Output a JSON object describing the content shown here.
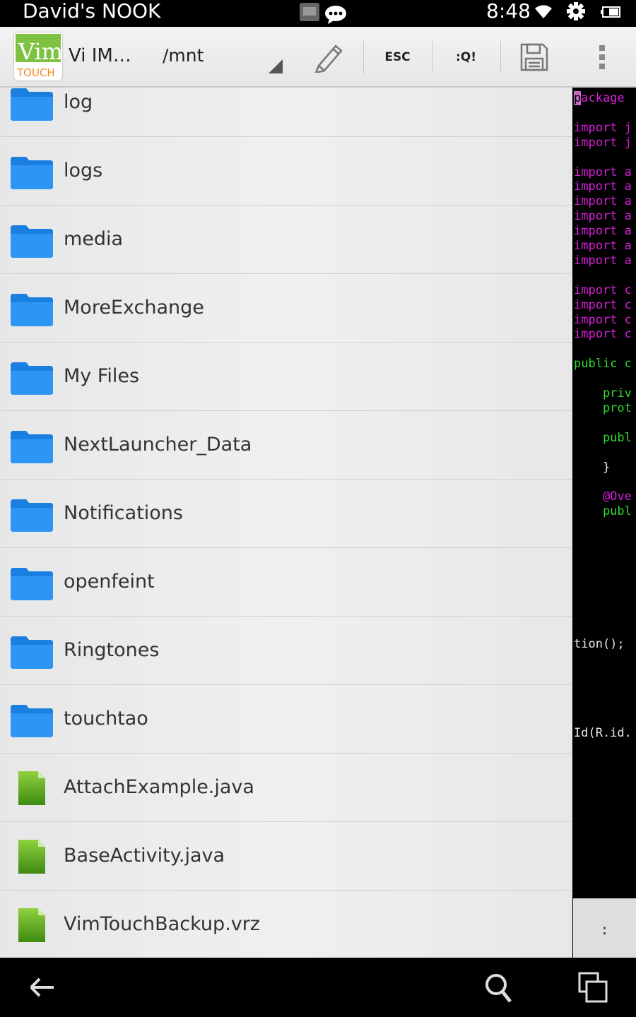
{
  "status_bar": {
    "device_name": "David's NOOK",
    "time": "8:48",
    "icons": [
      "vimtouch-notification-icon",
      "chat-icon",
      "wifi-icon",
      "settings-icon",
      "battery-icon"
    ]
  },
  "action_bar": {
    "app_title": "Vi IM…",
    "path": "/mnt",
    "logo_text_top": "Vim",
    "logo_text_bottom": "TOUCH",
    "buttons": {
      "edit": "edit-icon",
      "esc": "ESC",
      "quit": ":Q!",
      "save": "save-icon",
      "overflow": "overflow-menu-icon"
    }
  },
  "files": [
    {
      "name": "log",
      "type": "folder"
    },
    {
      "name": "logs",
      "type": "folder"
    },
    {
      "name": "media",
      "type": "folder"
    },
    {
      "name": "MoreExchange",
      "type": "folder"
    },
    {
      "name": "My Files",
      "type": "folder"
    },
    {
      "name": "NextLauncher_Data",
      "type": "folder"
    },
    {
      "name": "Notifications",
      "type": "folder"
    },
    {
      "name": "openfeint",
      "type": "folder"
    },
    {
      "name": "Ringtones",
      "type": "folder"
    },
    {
      "name": "touchtao",
      "type": "folder"
    },
    {
      "name": "AttachExample.java",
      "type": "file"
    },
    {
      "name": "BaseActivity.java",
      "type": "file"
    },
    {
      "name": "VimTouchBackup.vrz",
      "type": "file"
    }
  ],
  "terminal": {
    "lines": [
      {
        "row": 0,
        "text": "package",
        "color": "magenta"
      },
      {
        "row": 2,
        "text": "import j",
        "color": "magenta"
      },
      {
        "row": 3,
        "text": "import j",
        "color": "magenta"
      },
      {
        "row": 5,
        "text": "import a",
        "color": "magenta"
      },
      {
        "row": 6,
        "text": "import a",
        "color": "magenta"
      },
      {
        "row": 7,
        "text": "import a",
        "color": "magenta"
      },
      {
        "row": 8,
        "text": "import a",
        "color": "magenta"
      },
      {
        "row": 9,
        "text": "import a",
        "color": "magenta"
      },
      {
        "row": 10,
        "text": "import a",
        "color": "magenta"
      },
      {
        "row": 11,
        "text": "import a",
        "color": "magenta"
      },
      {
        "row": 13,
        "text": "import c",
        "color": "magenta"
      },
      {
        "row": 14,
        "text": "import c",
        "color": "magenta"
      },
      {
        "row": 15,
        "text": "import c",
        "color": "magenta"
      },
      {
        "row": 16,
        "text": "import c",
        "color": "magenta"
      },
      {
        "row": 18,
        "text": "public c",
        "color": "green"
      },
      {
        "row": 20,
        "text": "    priv",
        "color": "green"
      },
      {
        "row": 21,
        "text": "    prot",
        "color": "green"
      },
      {
        "row": 23,
        "text": "    publ",
        "color": "green"
      },
      {
        "row": 25,
        "text": "    }",
        "color": "white"
      },
      {
        "row": 27,
        "text": "    @Ove",
        "color": "magenta"
      },
      {
        "row": 28,
        "text": "    publ",
        "color": "green"
      },
      {
        "row": 37,
        "text": "tion();",
        "color": "white"
      },
      {
        "row": 43,
        "text": "Id(R.id.",
        "color": "white"
      }
    ],
    "command_line": ":"
  },
  "nav_bar": {
    "back": "back-icon",
    "search": "search-icon",
    "recent": "recent-apps-icon"
  },
  "colors": {
    "folder_blue": "#1e8ef0",
    "file_green": "#6ab628",
    "vim_magenta": "#d81fd8",
    "vim_green": "#2ed82e"
  }
}
